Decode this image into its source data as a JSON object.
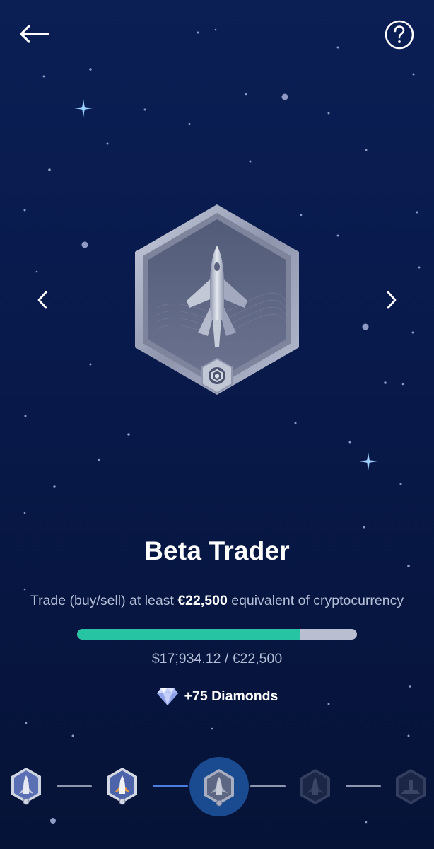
{
  "header": {
    "back_icon": "arrow-left-icon",
    "help_icon": "question-circle-icon"
  },
  "navigation": {
    "prev_icon": "chevron-left-icon",
    "next_icon": "chevron-right-icon"
  },
  "badge": {
    "icon": "rocket-badge-icon",
    "emblem_icon": "crypto-com-logo-icon",
    "title": "Beta Trader",
    "description_prefix": "Trade (buy/sell) at least ",
    "description_amount": "€22,500",
    "description_suffix": " equivalent of cryptocurrency"
  },
  "progress": {
    "current": 17934.12,
    "target": 22500,
    "fraction": 0.797,
    "label": "$17,934.12 / €22,500"
  },
  "reward": {
    "icon": "diamond-icon",
    "label": "+75 Diamonds"
  },
  "carousel": {
    "items": [
      {
        "name": "badge-level-1",
        "state": "completed"
      },
      {
        "name": "badge-level-2",
        "state": "completed"
      },
      {
        "name": "badge-level-3",
        "state": "active"
      },
      {
        "name": "badge-level-4",
        "state": "locked"
      },
      {
        "name": "badge-level-5",
        "state": "locked"
      }
    ]
  },
  "colors": {
    "background_top": "#0b1f55",
    "background_bottom": "#061337",
    "progress_fill": "#27c4a3",
    "progress_track": "#b9bed0",
    "connector_done": "#4d7de0"
  }
}
